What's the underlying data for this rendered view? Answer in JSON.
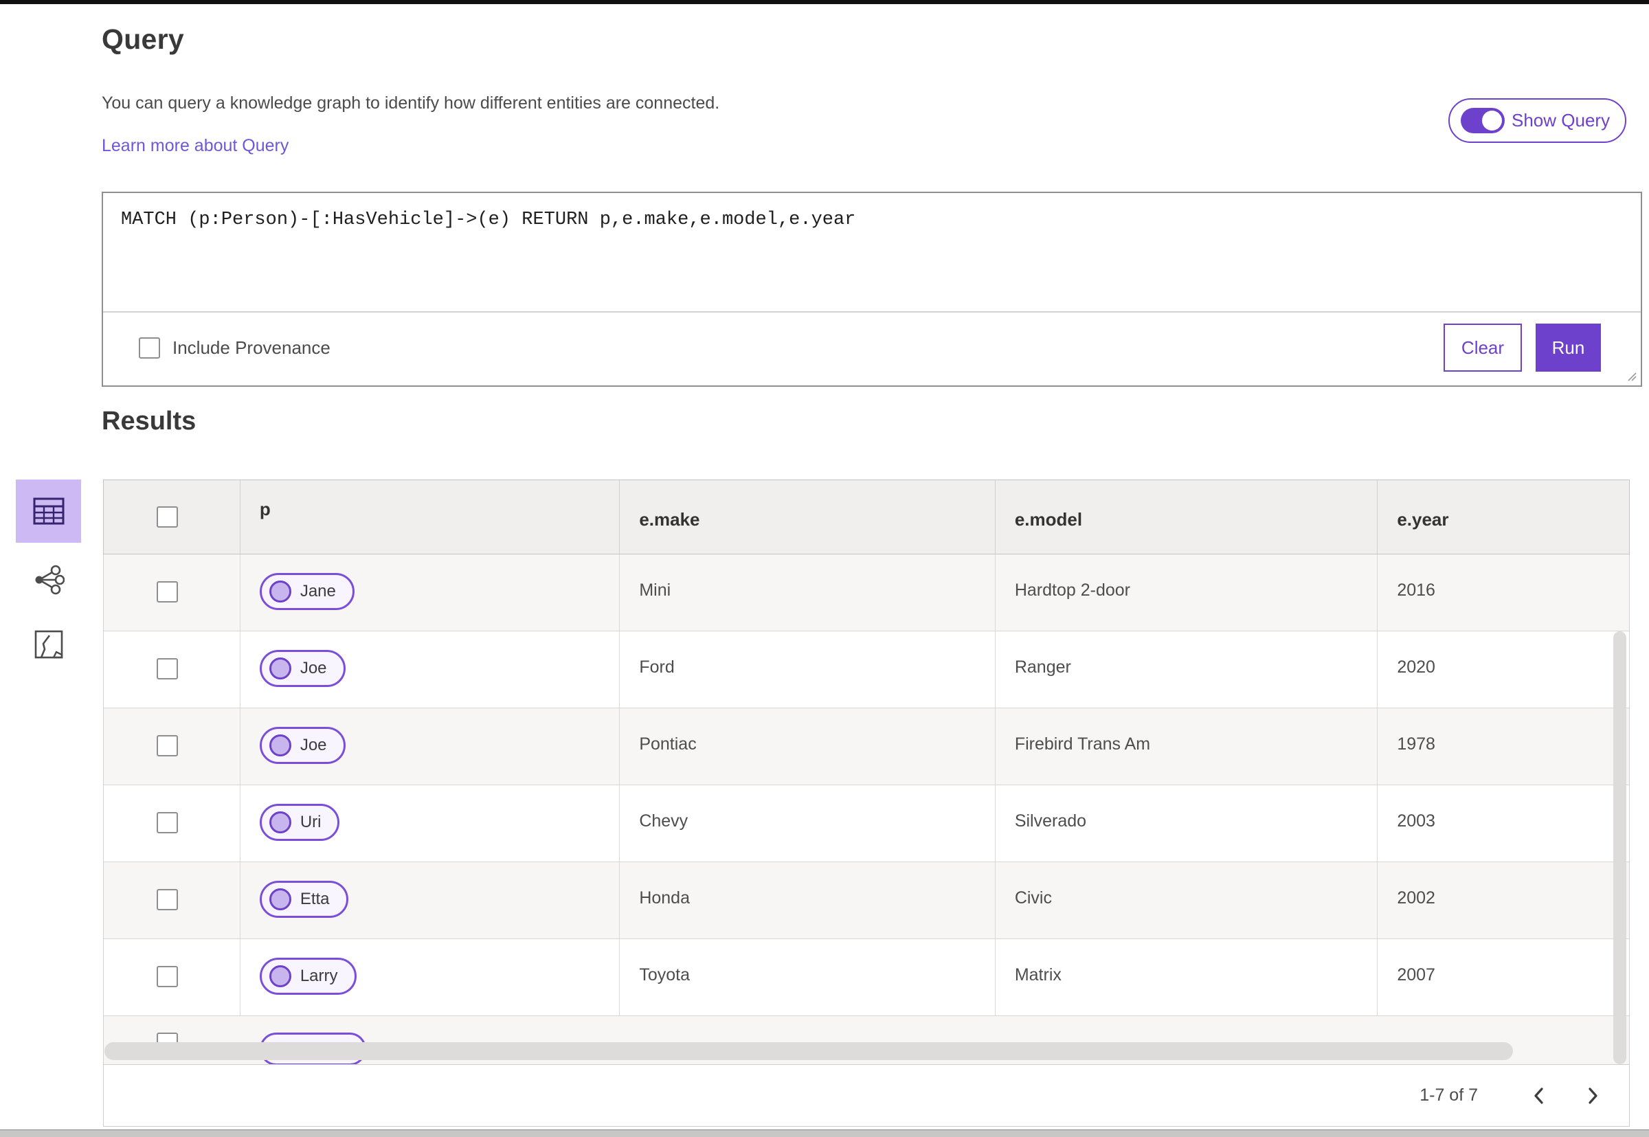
{
  "header": {
    "title": "Query",
    "description": "You can query a knowledge graph to identify how different entities are connected.",
    "learn_more": "Learn more about Query"
  },
  "toggle": {
    "label": "Show Query",
    "state": "on"
  },
  "query_editor": {
    "text": "MATCH (p:Person)-[:HasVehicle]->(e) RETURN p,e.make,e.model,e.year",
    "include_provenance_label": "Include Provenance",
    "include_provenance_checked": false,
    "clear_label": "Clear",
    "run_label": "Run"
  },
  "results": {
    "title": "Results"
  },
  "view_switcher": {
    "items": [
      {
        "id": "table-view",
        "selected": true
      },
      {
        "id": "graph-view",
        "selected": false
      },
      {
        "id": "map-view",
        "selected": false
      }
    ]
  },
  "table": {
    "columns": [
      "p",
      "e.make",
      "e.model",
      "e.year"
    ],
    "rows": [
      {
        "p": "Jane",
        "make": "Mini",
        "model": "Hardtop 2-door",
        "year": "2016"
      },
      {
        "p": "Joe",
        "make": "Ford",
        "model": "Ranger",
        "year": "2020"
      },
      {
        "p": "Joe",
        "make": "Pontiac",
        "model": "Firebird Trans Am",
        "year": "1978"
      },
      {
        "p": "Uri",
        "make": "Chevy",
        "model": "Silverado",
        "year": "2003"
      },
      {
        "p": "Etta",
        "make": "Honda",
        "model": "Civic",
        "year": "2002"
      },
      {
        "p": "Larry",
        "make": "Toyota",
        "model": "Matrix",
        "year": "2007"
      }
    ],
    "has_partial_seventh_row": true,
    "pagination": {
      "range_label": "1-7 of 7"
    }
  },
  "colors": {
    "accent": "#6d41cb",
    "accent_light": "#cdb9f3",
    "link": "#6f58d8",
    "pill_fill": "#f8f5fe",
    "row_alt": "#f7f6f5"
  }
}
